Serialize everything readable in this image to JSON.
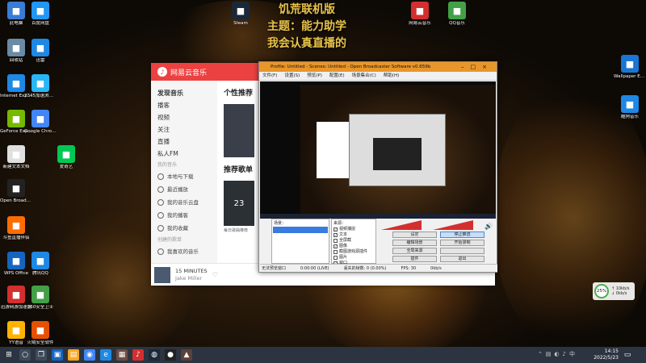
{
  "overlay": {
    "line1": "饥荒联机版",
    "line2": "主题：能力助学",
    "line3": "我会认真直播的"
  },
  "desktop_icons": [
    {
      "label": "此电脑",
      "icon": "computer-icon",
      "color": "#3a7bd5"
    },
    {
      "label": "回收站",
      "icon": "recycle-bin-icon",
      "color": "#6a8aa5"
    },
    {
      "label": "Internet Explorer",
      "icon": "ie-icon",
      "color": "#1e88e5"
    },
    {
      "label": "GeForce Experience",
      "icon": "geforce-icon",
      "color": "#76b900"
    },
    {
      "label": "新建文本文档",
      "icon": "text-file-icon",
      "color": "#e0e0e0"
    },
    {
      "label": "Open Broadcast...",
      "icon": "obs-icon",
      "color": "#222222"
    },
    {
      "label": "斗鱼直播伴侣",
      "icon": "douyu-icon",
      "color": "#ff6d00"
    },
    {
      "label": "WPS Office",
      "icon": "wps-icon",
      "color": "#1565c0"
    },
    {
      "label": "迅游网游加速器",
      "icon": "xunyou-icon",
      "color": "#d32f2f"
    },
    {
      "label": "YY语音",
      "icon": "yy-icon",
      "color": "#ffb300"
    },
    {
      "label": "火绒安全软件",
      "icon": "huorong-icon",
      "color": "#e65100"
    },
    {
      "label": "百度网盘",
      "icon": "baidu-icon",
      "color": "#2196f3"
    },
    {
      "label": "Google Chrome",
      "icon": "chrome-icon",
      "color": "#4285f4"
    },
    {
      "label": "2345加速浏览器",
      "icon": "browser-icon",
      "color": "#29b6f6"
    },
    {
      "label": "迅雷",
      "icon": "thunder-icon",
      "color": "#1e88e5"
    },
    {
      "label": "爱奇艺",
      "icon": "iqiyi-icon",
      "color": "#00c853"
    },
    {
      "label": "360安全卫士",
      "icon": "360-icon",
      "color": "#43a047"
    },
    {
      "label": "腾讯QQ",
      "icon": "qq-icon",
      "color": "#1e88e5"
    },
    {
      "label": "Steam",
      "icon": "steam-icon",
      "color": "#1b2838"
    },
    {
      "label": "网易云音乐",
      "icon": "netease-icon",
      "color": "#d32f2f"
    },
    {
      "label": "QQ音乐",
      "icon": "qqmusic-icon",
      "color": "#43a047"
    },
    {
      "label": "Wallpaper Engine",
      "icon": "wallpaper-icon",
      "color": "#1976d2"
    },
    {
      "label": "酷狗音乐",
      "icon": "kugou-icon",
      "color": "#1e88e5"
    }
  ],
  "netease": {
    "title": "网易云音乐",
    "menu_active": "发现音乐",
    "menu": [
      "播客",
      "视频",
      "关注",
      "直播",
      "私人FM"
    ],
    "section_my": "我的音乐",
    "my_items": [
      "本地与下载",
      "最近播放",
      "我的音乐云盘",
      "我的播客",
      "我的收藏"
    ],
    "section_created": "创建的歌单",
    "created_items": [
      "我喜欢的音乐"
    ],
    "main_heading": "个性推荐",
    "recommend_heading": "推荐歌单",
    "daily_label": "每日歌曲推荐",
    "calendar_day": "23",
    "player": {
      "song": "15 MINUTES",
      "artist": "Jake Miller"
    }
  },
  "obs": {
    "title": "Profile: Untitled - Scenes: Untitled - Open Broadcaster Software v0.659b",
    "menu": [
      "文件(F)",
      "设置(S)",
      "预览(P)",
      "配置(E)",
      "场景集合(C)",
      "帮助(H)"
    ],
    "scenes_label": "场景：",
    "sources_label": "来源：",
    "sources": [
      {
        "name": "视频捕捉",
        "checked": true
      },
      {
        "name": "文本",
        "checked": true
      },
      {
        "name": "全屏截",
        "checked": false
      },
      {
        "name": "图像",
        "checked": true
      },
      {
        "name": "截图游戏源插件",
        "checked": false
      },
      {
        "name": "图片",
        "checked": false
      },
      {
        "name": "窗口",
        "checked": true
      },
      {
        "name": "显示器",
        "checked": false
      }
    ],
    "buttons": [
      "设定",
      "停止推流",
      "编辑场景",
      "开始录制",
      "全局来源",
      "",
      "插件",
      "退出"
    ],
    "status": {
      "preview": "无法预览窗口",
      "time": "0:00:00 (LIVE)",
      "dropped": "丢失的帧数: 0 (0.00%)",
      "fps": "FPS: 30",
      "bitrate": "0kb/s"
    }
  },
  "tray_widget": {
    "percent": "25%",
    "up": "↑ 10kb/s",
    "down": "↓ 0kb/s"
  },
  "taskbar": {
    "time": "14:15",
    "date": "2022/5/23"
  }
}
